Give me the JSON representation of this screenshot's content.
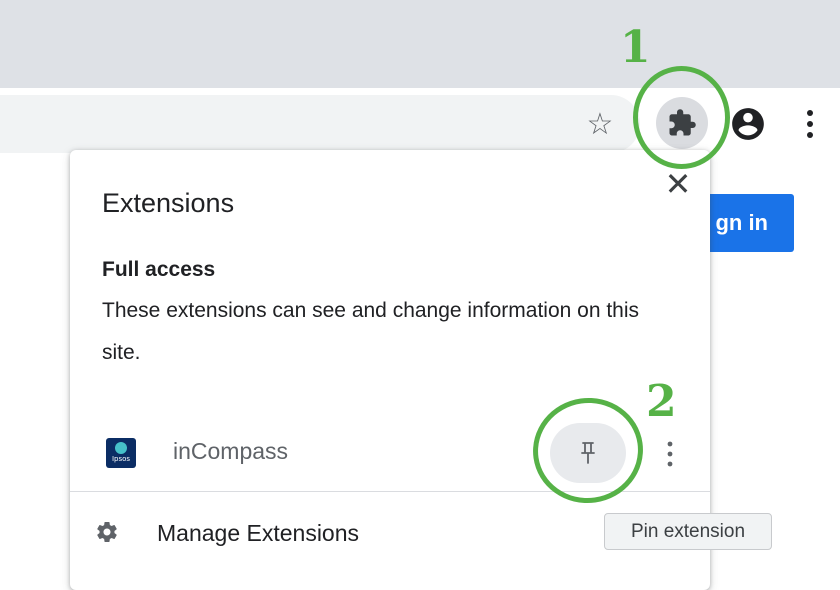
{
  "toolbar": {
    "bookmark_icon": "star-outline-icon",
    "extensions_icon": "puzzle-icon",
    "profile_icon": "account-circle-icon",
    "menu_icon": "more-vert-icon"
  },
  "page": {
    "signin_label": "gn in"
  },
  "annotations": {
    "step1": "1",
    "step2": "2",
    "color": "#56b247"
  },
  "popup": {
    "title": "Extensions",
    "close_glyph": "✕",
    "section": {
      "heading": "Full access",
      "description": "These extensions can see and change information on this site."
    },
    "extension": {
      "name": "inCompass",
      "logo_text": "Ipsos",
      "pin_icon": "pin-icon",
      "more_icon": "more-vert-icon"
    },
    "manage_label": "Manage Extensions",
    "manage_icon": "gear-icon"
  },
  "tooltip": {
    "text": "Pin extension"
  }
}
